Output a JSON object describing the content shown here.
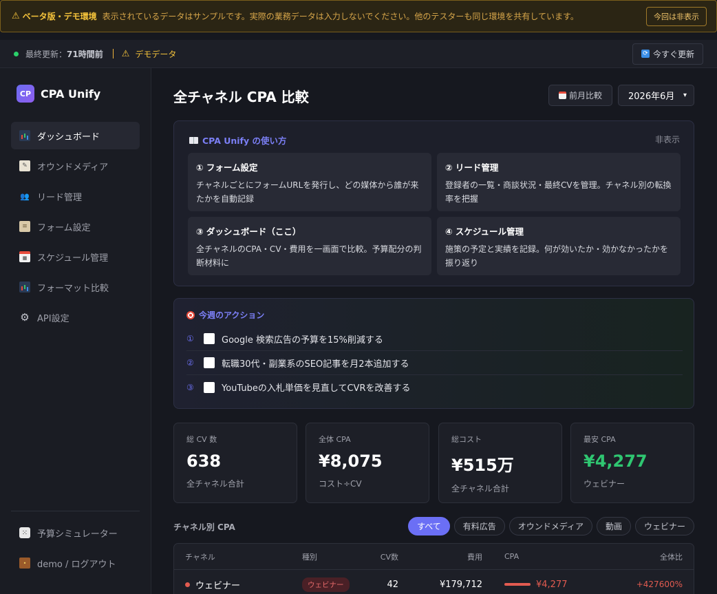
{
  "banner": {
    "label": "ベータ版・デモ環境",
    "message": "表示されているデータはサンプルです。実際の業務データは入力しないでください。他のテスターも同じ環境を共有しています。",
    "hide_button": "今回は非表示"
  },
  "status": {
    "updated_label": "最終更新：",
    "updated_value": "71時間前",
    "demo_label": "デモデータ",
    "refresh_button": "今すぐ更新"
  },
  "brand": {
    "logo": "CP",
    "name": "CPA Unify"
  },
  "nav": {
    "items": [
      {
        "label": "ダッシュボード",
        "icon": "bar-chart-icon",
        "active": true
      },
      {
        "label": "オウンドメディア",
        "icon": "memo-icon"
      },
      {
        "label": "リード管理",
        "icon": "people-icon"
      },
      {
        "label": "フォーム設定",
        "icon": "clipboard-icon"
      },
      {
        "label": "スケジュール管理",
        "icon": "calendar-icon"
      },
      {
        "label": "フォーマット比較",
        "icon": "bar-chart-icon"
      },
      {
        "label": "API設定",
        "icon": "gear-icon"
      }
    ],
    "bottom": [
      {
        "label": "予算シミュレーター",
        "icon": "dice-icon"
      },
      {
        "label": "demo / ログアウト",
        "icon": "door-icon"
      }
    ]
  },
  "page": {
    "title": "全チャネル CPA 比較",
    "prev_button": "前月比較",
    "month": "2026年6月"
  },
  "guide": {
    "title": "CPA Unify の使い方",
    "hide": "非表示",
    "boxes": [
      {
        "title": "① フォーム設定",
        "text": "チャネルごとにフォームURLを発行し、どの媒体から誰が来たかを自動記録"
      },
      {
        "title": "② リード管理",
        "text": "登録者の一覧・商談状況・最終CVを管理。チャネル別の転換率を把握"
      },
      {
        "title": "③ ダッシュボード（ここ）",
        "text": "全チャネルのCPA・CV・費用を一画面で比較。予算配分の判断材料に"
      },
      {
        "title": "④ スケジュール管理",
        "text": "施策の予定と実績を記録。何が効いたか・効かなかったかを振り返り"
      }
    ]
  },
  "actions": {
    "title": "今週のアクション",
    "items": [
      {
        "num": "①",
        "text": "Google 検索広告の予算を15%削減する"
      },
      {
        "num": "②",
        "text": "転職30代・副業系のSEO記事を月2本追加する"
      },
      {
        "num": "③",
        "text": "YouTubeの入札単価を見直してCVRを改善する"
      }
    ]
  },
  "kpis": [
    {
      "label": "総 CV 数",
      "value": "638",
      "sub": "全チャネル合計"
    },
    {
      "label": "全体 CPA",
      "value": "¥8,075",
      "sub": "コスト÷CV"
    },
    {
      "label": "総コスト",
      "value": "¥515万",
      "sub": "全チャネル合計"
    },
    {
      "label": "最安 CPA",
      "value": "¥4,277",
      "sub": "ウェビナー",
      "color": "#2fc671"
    }
  ],
  "channel_section": {
    "title": "チャネル別 CPA",
    "filters": [
      "すべて",
      "有料広告",
      "オウンドメディア",
      "動画",
      "ウェビナー"
    ],
    "active_filter": "すべて"
  },
  "table": {
    "headers": [
      "チャネル",
      "種別",
      "CV数",
      "費用",
      "CPA",
      "全体比"
    ],
    "rows": [
      {
        "channel": "ウェビナー",
        "type": "ウェビナー",
        "cv": "42",
        "cost": "¥179,712",
        "cpa": "¥4,277",
        "ratio": "+427600%"
      }
    ]
  }
}
